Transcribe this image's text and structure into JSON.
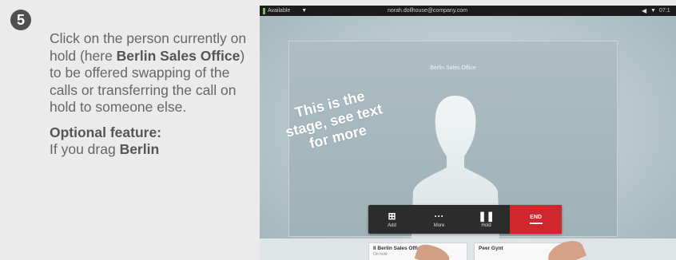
{
  "step": {
    "number": "5"
  },
  "instructions": {
    "text_before": "Click on the person currently on hold (here ",
    "highlight": "Berlin Sales Office",
    "text_after": ") to be offered swapping of the calls or transferring the call on hold to someone else.",
    "optional_title": "Optional feature:",
    "optional_text_before": "If you drag ",
    "optional_highlight": "Berlin"
  },
  "screen": {
    "status": {
      "availability": "Available",
      "email": "norah.dollhouse@company.com",
      "time": "07:1"
    },
    "stage": {
      "participant": "Berlin Sales Office",
      "overlay": "This is the stage, see text for more"
    },
    "toolbar": {
      "add_label": "Add",
      "more_label": "More",
      "hold_label": "Hold",
      "end_label": "END"
    },
    "calls": [
      {
        "name": "II Berlin Sales Office",
        "status": "On hold"
      },
      {
        "name": "Peer Gynt",
        "status": ""
      }
    ]
  },
  "colors": {
    "end_button": "#d0262d",
    "status_available": "#6fc24a",
    "step_badge": "#505050"
  }
}
